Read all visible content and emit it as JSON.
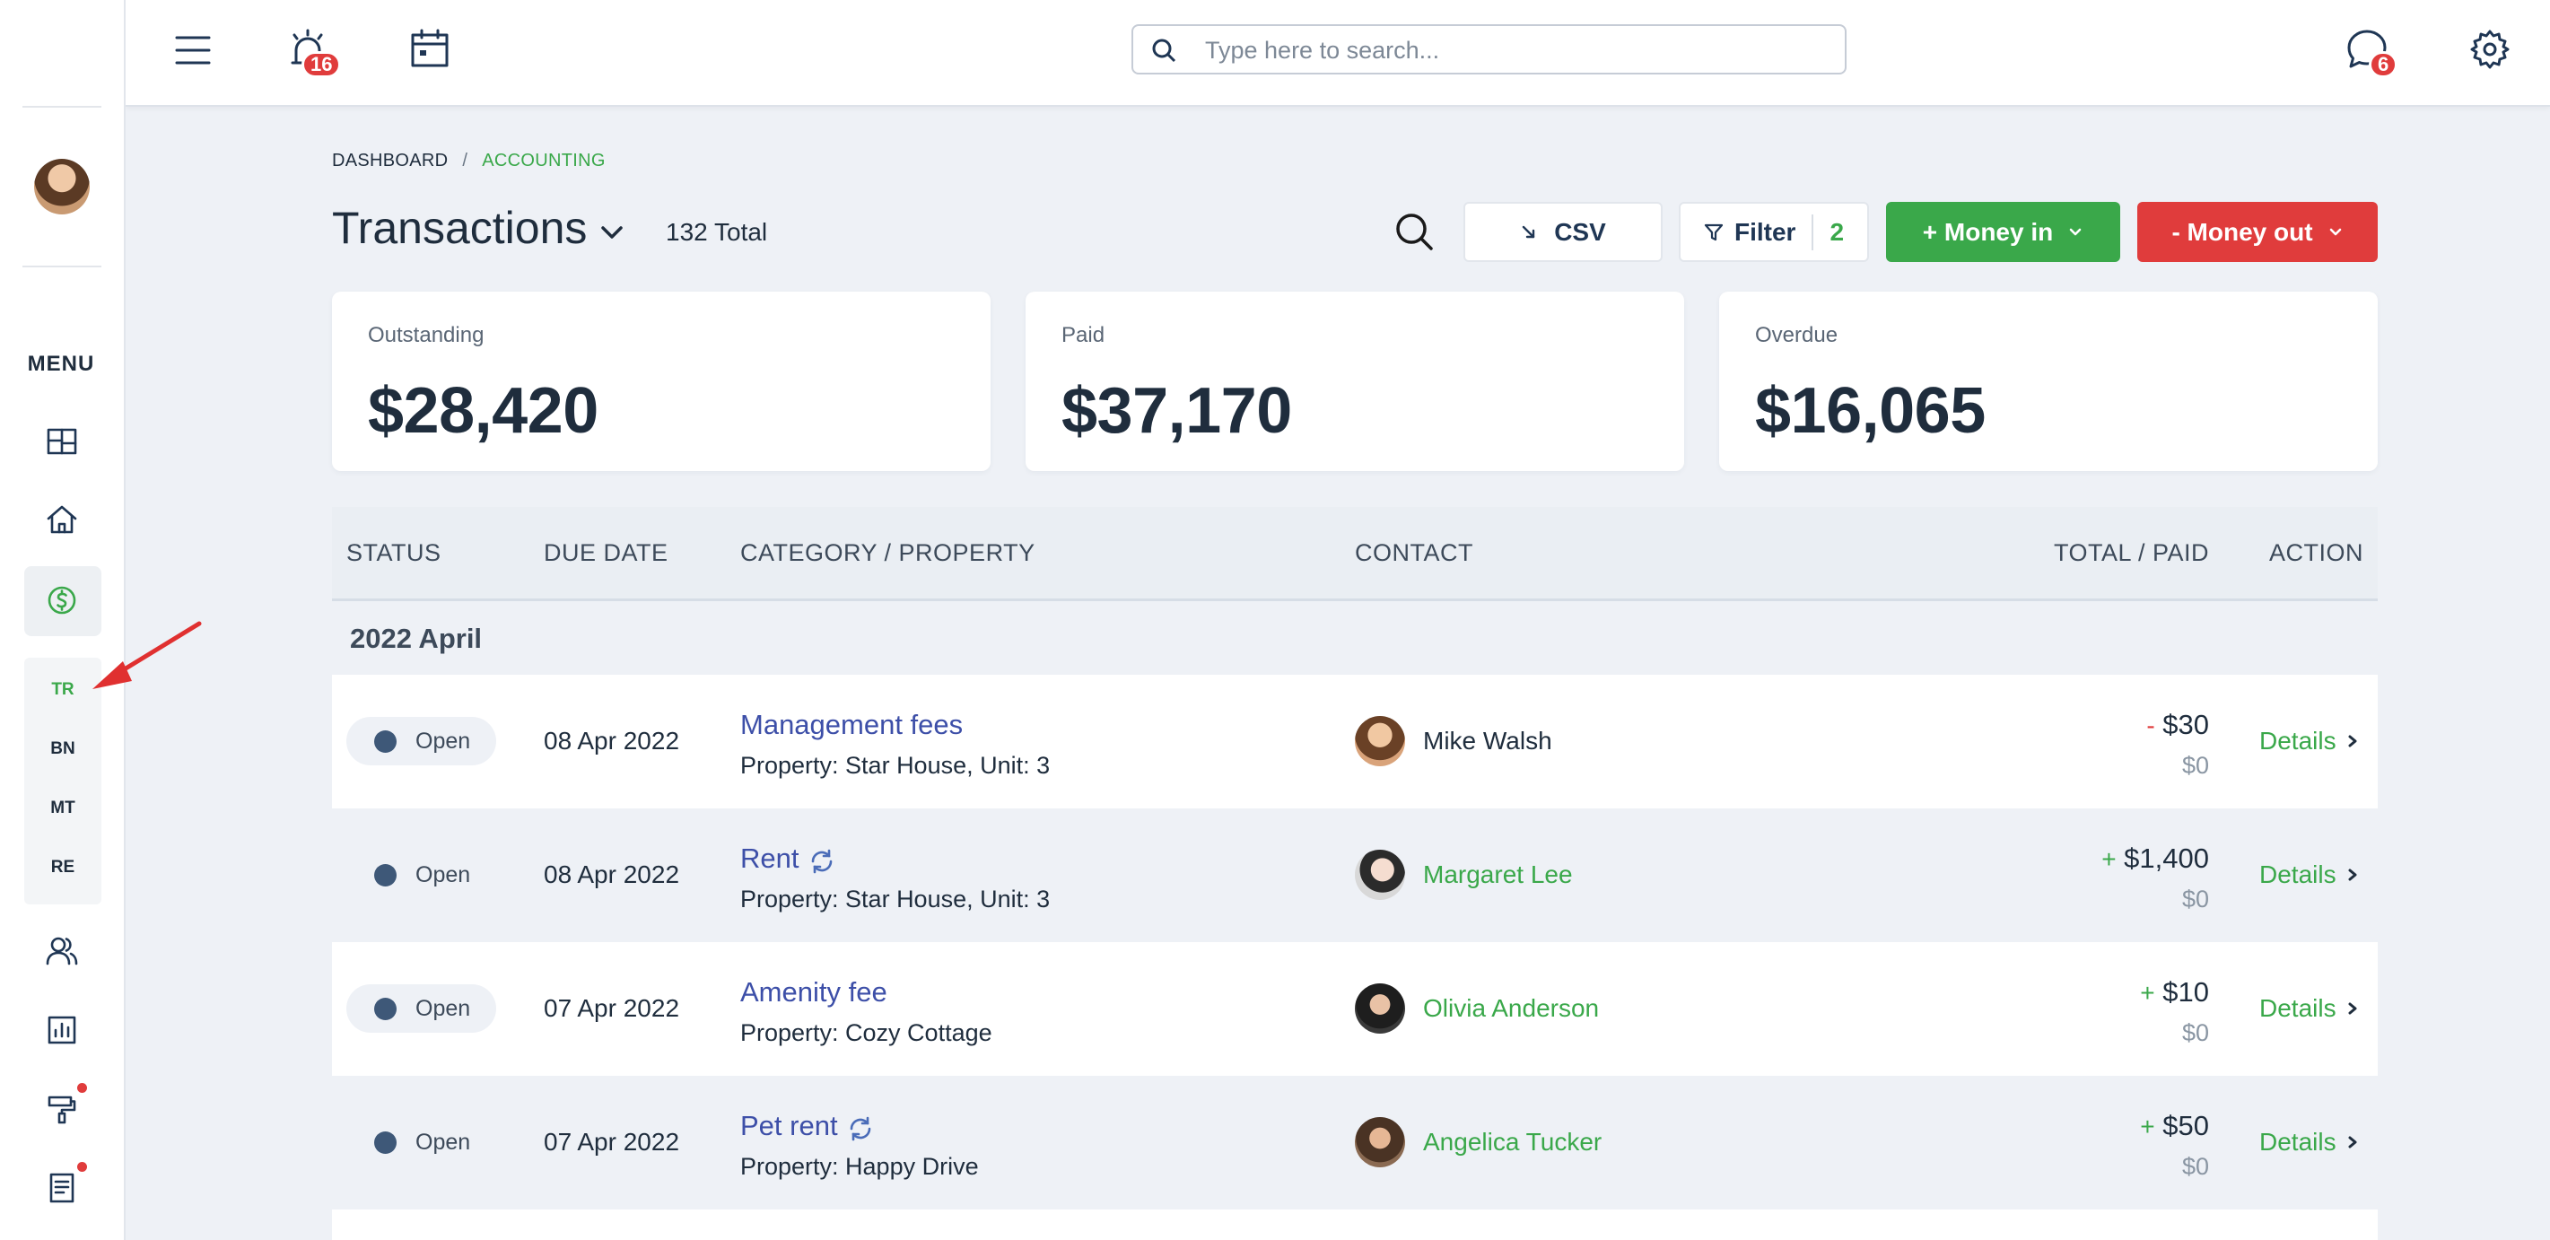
{
  "topbar": {
    "alarm_badge": "16",
    "search_placeholder": "Type here to search...",
    "messages_badge": "6"
  },
  "sidebar": {
    "menu_label": "MENU",
    "sub_items": [
      "TR",
      "BN",
      "MT",
      "RE"
    ],
    "icons": [
      "dashboard-icon",
      "home-icon",
      "accounting-icon",
      "people-icon",
      "reports-icon",
      "maintenance-icon",
      "documents-icon"
    ]
  },
  "breadcrumb": {
    "dashboard": "DASHBOARD",
    "separator": "/",
    "current": "ACCOUNTING"
  },
  "header": {
    "title": "Transactions",
    "total": "132 Total",
    "csv_label": "CSV",
    "filter_label": "Filter",
    "filter_count": "2",
    "money_in_label": "+ Money in",
    "money_out_label": "- Money out"
  },
  "summary": {
    "outstanding_label": "Outstanding",
    "outstanding_value": "$28,420",
    "paid_label": "Paid",
    "paid_value": "$37,170",
    "overdue_label": "Overdue",
    "overdue_value": "$16,065"
  },
  "table": {
    "columns": [
      "STATUS",
      "DUE DATE",
      "CATEGORY / PROPERTY",
      "CONTACT",
      "TOTAL / PAID",
      "ACTION"
    ],
    "group": "2022 April",
    "rows": [
      {
        "status": "Open",
        "due": "08 Apr 2022",
        "category": "Management fees",
        "property": "Property: Star House, Unit: 3",
        "contact": "Mike Walsh",
        "sign": "-",
        "amount": "$30",
        "paid": "$0",
        "action": "Details"
      },
      {
        "status": "Open",
        "due": "08 Apr 2022",
        "category": "Rent",
        "property": "Property: Star House, Unit: 3",
        "contact": "Margaret Lee",
        "sign": "+",
        "amount": "$1,400",
        "paid": "$0",
        "action": "Details"
      },
      {
        "status": "Open",
        "due": "07 Apr 2022",
        "category": "Amenity fee",
        "property": "Property: Cozy Cottage",
        "contact": "Olivia Anderson",
        "sign": "+",
        "amount": "$10",
        "paid": "$0",
        "action": "Details"
      },
      {
        "status": "Open",
        "due": "07 Apr 2022",
        "category": "Pet rent",
        "property": "Property: Happy Drive",
        "contact": "Angelica Tucker",
        "sign": "+",
        "amount": "$50",
        "paid": "$0",
        "action": "Details"
      }
    ]
  },
  "colors": {
    "accent_green": "#3aa84a",
    "danger_red": "#e03c3c",
    "link_blue": "#3d4fa8",
    "text_dark": "#1f2d3d"
  }
}
